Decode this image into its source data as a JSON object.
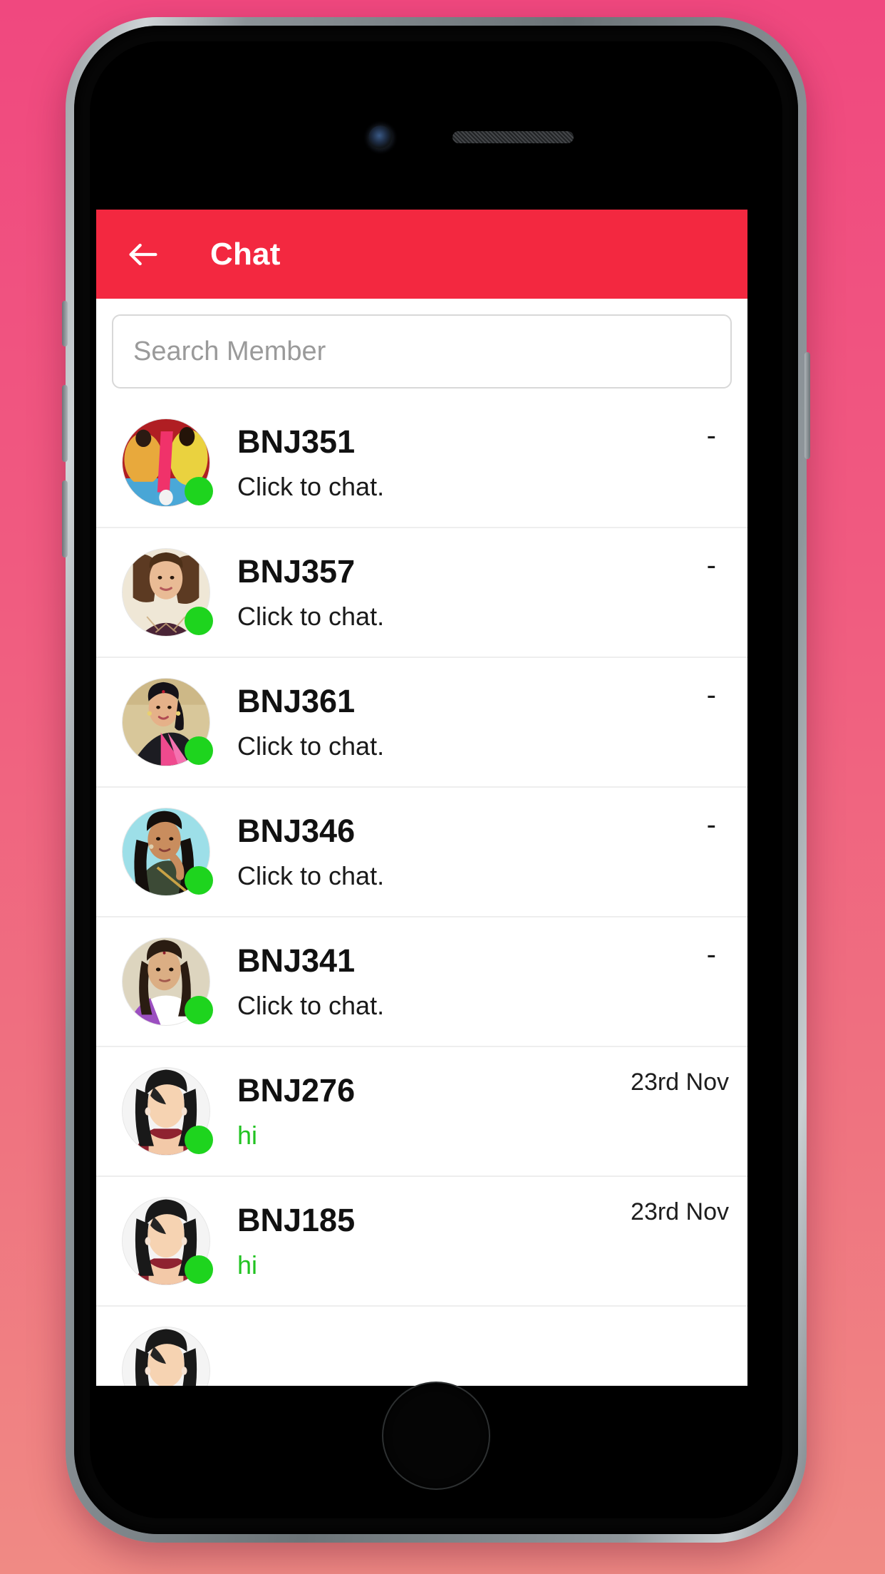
{
  "app": {
    "header": {
      "back_icon": "arrow-left-icon",
      "title": "Chat",
      "background_color": "#f32840",
      "title_color": "#ffffff"
    },
    "search": {
      "placeholder": "Search Member",
      "value": "",
      "border_color": "#d8d8d8"
    },
    "colors": {
      "accent_red": "#f32840",
      "online_green": "#1ed41e",
      "message_green": "#22c322",
      "bg_top": "#f0487f",
      "bg_bottom": "#f08a84",
      "divider": "#eeeeee"
    },
    "chat_list": [
      {
        "name": "BNJ351",
        "message": "Click to chat.",
        "message_style": "default",
        "time": "-",
        "online": true,
        "avatar": "photo-two-women-saree"
      },
      {
        "name": "BNJ357",
        "message": "Click to chat.",
        "message_style": "default",
        "time": "-",
        "online": true,
        "avatar": "photo-woman-curly-hair"
      },
      {
        "name": "BNJ361",
        "message": "Click to chat.",
        "message_style": "default",
        "time": "-",
        "online": true,
        "avatar": "photo-woman-pink-saree"
      },
      {
        "name": "BNJ346",
        "message": "Click to chat.",
        "message_style": "default",
        "time": "-",
        "online": true,
        "avatar": "photo-woman-green-top"
      },
      {
        "name": "BNJ341",
        "message": "Click to chat.",
        "message_style": "default",
        "time": "-",
        "online": true,
        "avatar": "photo-woman-purple-jacket"
      },
      {
        "name": "BNJ276",
        "message": "hi",
        "message_style": "green",
        "time": "23rd Nov",
        "online": true,
        "avatar": "default-female-illustration"
      },
      {
        "name": "BNJ185",
        "message": "hi",
        "message_style": "green",
        "time": "23rd Nov",
        "online": true,
        "avatar": "default-female-illustration"
      },
      {
        "name": "",
        "message": "",
        "message_style": "default",
        "time": "",
        "online": false,
        "avatar": "default-female-illustration",
        "partial": true
      }
    ]
  },
  "device": {
    "camera_icon": "front-camera-icon",
    "speaker_icon": "earpiece-speaker-icon",
    "home_button_icon": "home-button-icon"
  }
}
